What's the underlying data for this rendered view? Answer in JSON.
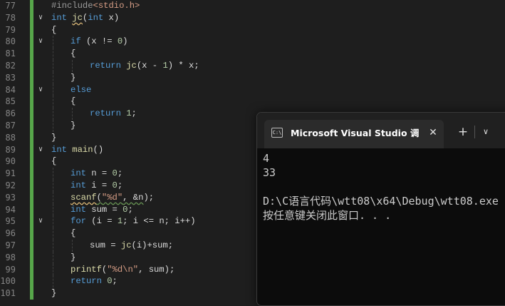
{
  "editor": {
    "lines": [
      {
        "n": "77",
        "indent": 0,
        "fold": "",
        "tokens": [
          {
            "t": "#include",
            "c": "pp"
          },
          {
            "t": "<stdio.h>",
            "c": "inc"
          }
        ]
      },
      {
        "n": "78",
        "indent": 0,
        "fold": "v",
        "tokens": [
          {
            "t": "int",
            "c": "kw"
          },
          {
            "t": " "
          },
          {
            "t": "jc",
            "c": "fn sq"
          },
          {
            "t": "("
          },
          {
            "t": "int",
            "c": "kw"
          },
          {
            "t": " x)"
          }
        ]
      },
      {
        "n": "79",
        "indent": 0,
        "fold": "",
        "tokens": [
          {
            "t": "{"
          }
        ]
      },
      {
        "n": "80",
        "indent": 1,
        "fold": "v",
        "tokens": [
          {
            "t": "if",
            "c": "kw"
          },
          {
            "t": " (x != "
          },
          {
            "t": "0",
            "c": "num"
          },
          {
            "t": ")"
          }
        ]
      },
      {
        "n": "81",
        "indent": 1,
        "fold": "",
        "tokens": [
          {
            "t": "{"
          }
        ]
      },
      {
        "n": "82",
        "indent": 2,
        "fold": "",
        "tokens": [
          {
            "t": "return",
            "c": "kw"
          },
          {
            "t": " "
          },
          {
            "t": "jc",
            "c": "fn"
          },
          {
            "t": "(x - "
          },
          {
            "t": "1",
            "c": "num"
          },
          {
            "t": ") * x;"
          }
        ]
      },
      {
        "n": "83",
        "indent": 1,
        "fold": "",
        "tokens": [
          {
            "t": "}"
          }
        ]
      },
      {
        "n": "84",
        "indent": 1,
        "fold": "v",
        "tokens": [
          {
            "t": "else",
            "c": "kw"
          }
        ]
      },
      {
        "n": "85",
        "indent": 1,
        "fold": "",
        "tokens": [
          {
            "t": "{"
          }
        ]
      },
      {
        "n": "86",
        "indent": 2,
        "fold": "",
        "tokens": [
          {
            "t": "return",
            "c": "kw"
          },
          {
            "t": " "
          },
          {
            "t": "1",
            "c": "num"
          },
          {
            "t": ";"
          }
        ]
      },
      {
        "n": "87",
        "indent": 1,
        "fold": "",
        "tokens": [
          {
            "t": "}"
          }
        ]
      },
      {
        "n": "88",
        "indent": 0,
        "fold": "",
        "tokens": [
          {
            "t": "}"
          }
        ]
      },
      {
        "n": "89",
        "indent": 0,
        "fold": "v",
        "tokens": [
          {
            "t": "int",
            "c": "kw"
          },
          {
            "t": " "
          },
          {
            "t": "main",
            "c": "fn"
          },
          {
            "t": "()"
          }
        ]
      },
      {
        "n": "90",
        "indent": 0,
        "fold": "",
        "tokens": [
          {
            "t": "{"
          }
        ]
      },
      {
        "n": "91",
        "indent": 1,
        "fold": "",
        "tokens": [
          {
            "t": "int",
            "c": "kw"
          },
          {
            "t": " n = "
          },
          {
            "t": "0",
            "c": "num"
          },
          {
            "t": ";"
          }
        ]
      },
      {
        "n": "92",
        "indent": 1,
        "fold": "",
        "tokens": [
          {
            "t": "int",
            "c": "kw"
          },
          {
            "t": " i = "
          },
          {
            "t": "0",
            "c": "num"
          },
          {
            "t": ";"
          }
        ]
      },
      {
        "n": "93",
        "indent": 1,
        "fold": "",
        "tokens": [
          {
            "t": "scanf",
            "c": "fn sq"
          },
          {
            "t": "(",
            "c": "sqg"
          },
          {
            "t": "\"%d\"",
            "c": "str sqg"
          },
          {
            "t": ", &n",
            "c": "sqg"
          },
          {
            "t": ");"
          }
        ]
      },
      {
        "n": "94",
        "indent": 1,
        "fold": "",
        "tokens": [
          {
            "t": "int",
            "c": "kw"
          },
          {
            "t": " sum = "
          },
          {
            "t": "0",
            "c": "num"
          },
          {
            "t": ";"
          }
        ]
      },
      {
        "n": "95",
        "indent": 1,
        "fold": "v",
        "tokens": [
          {
            "t": "for",
            "c": "kw"
          },
          {
            "t": " (i = "
          },
          {
            "t": "1",
            "c": "num"
          },
          {
            "t": "; i <= n; i++)"
          }
        ]
      },
      {
        "n": "96",
        "indent": 1,
        "fold": "",
        "tokens": [
          {
            "t": "{"
          }
        ]
      },
      {
        "n": "97",
        "indent": 2,
        "fold": "",
        "tokens": [
          {
            "t": "sum = "
          },
          {
            "t": "jc",
            "c": "fn"
          },
          {
            "t": "(i)+sum;"
          }
        ]
      },
      {
        "n": "98",
        "indent": 1,
        "fold": "",
        "tokens": [
          {
            "t": "}"
          }
        ]
      },
      {
        "n": "99",
        "indent": 1,
        "fold": "",
        "tokens": [
          {
            "t": "printf",
            "c": "fn"
          },
          {
            "t": "("
          },
          {
            "t": "\"%d\\n\"",
            "c": "str"
          },
          {
            "t": ", sum);"
          }
        ]
      },
      {
        "n": "100",
        "indent": 1,
        "fold": "",
        "tokens": [
          {
            "t": "return",
            "c": "kw"
          },
          {
            "t": " "
          },
          {
            "t": "0",
            "c": "num"
          },
          {
            "t": ";"
          }
        ]
      },
      {
        "n": "101",
        "indent": 0,
        "fold": "",
        "tokens": [
          {
            "t": "}"
          }
        ]
      }
    ]
  },
  "terminal": {
    "tab_icon": "C:\\",
    "tab_title": "Microsoft Visual Studio 调试控制台",
    "close_label": "✕",
    "new_tab_label": "+",
    "dropdown_label": "∨",
    "output": [
      "4",
      "33",
      "",
      "D:\\C语言代码\\wtt08\\x64\\Debug\\wtt08.exe",
      "按任意键关闭此窗口. . ."
    ]
  },
  "colors": {
    "editor_bg": "#1e1e1e",
    "keyword": "#569cd6",
    "function": "#dcdcaa",
    "string": "#d69d85",
    "number": "#b5cea8",
    "change_bar": "#57a64a",
    "terminal_bg": "#0c0c0c"
  }
}
